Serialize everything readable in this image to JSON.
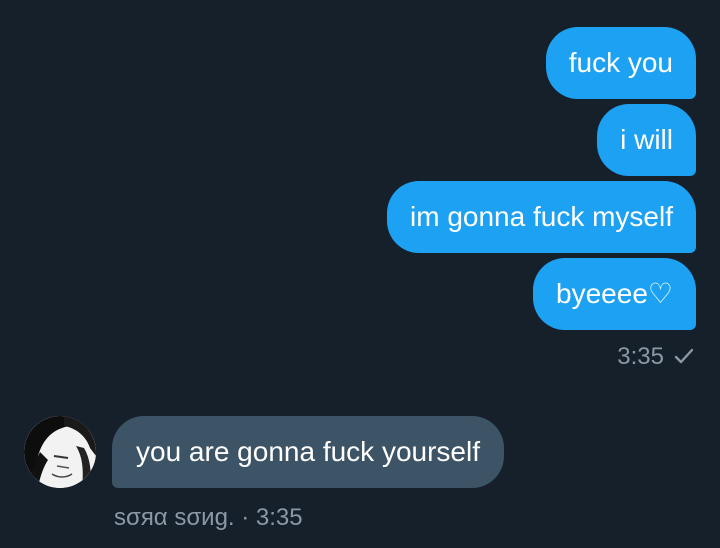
{
  "thread": {
    "outgoing": [
      {
        "text": "fuck you"
      },
      {
        "text": "i will"
      },
      {
        "text": "im gonna fuck myself"
      },
      {
        "text": "byeeee♡"
      }
    ],
    "outgoing_time": "3:35",
    "incoming": [
      {
        "text": "you are gonna fuck yourself"
      }
    ],
    "incoming_meta": "ѕσяα ѕσиg. · 3:35"
  },
  "icons": {
    "read_receipt": "check-icon",
    "avatar": "avatar-image"
  },
  "colors": {
    "background": "#15202b",
    "outgoing_bubble": "#1da1f2",
    "incoming_bubble": "#3d5466",
    "meta_text": "#8b98a5"
  }
}
